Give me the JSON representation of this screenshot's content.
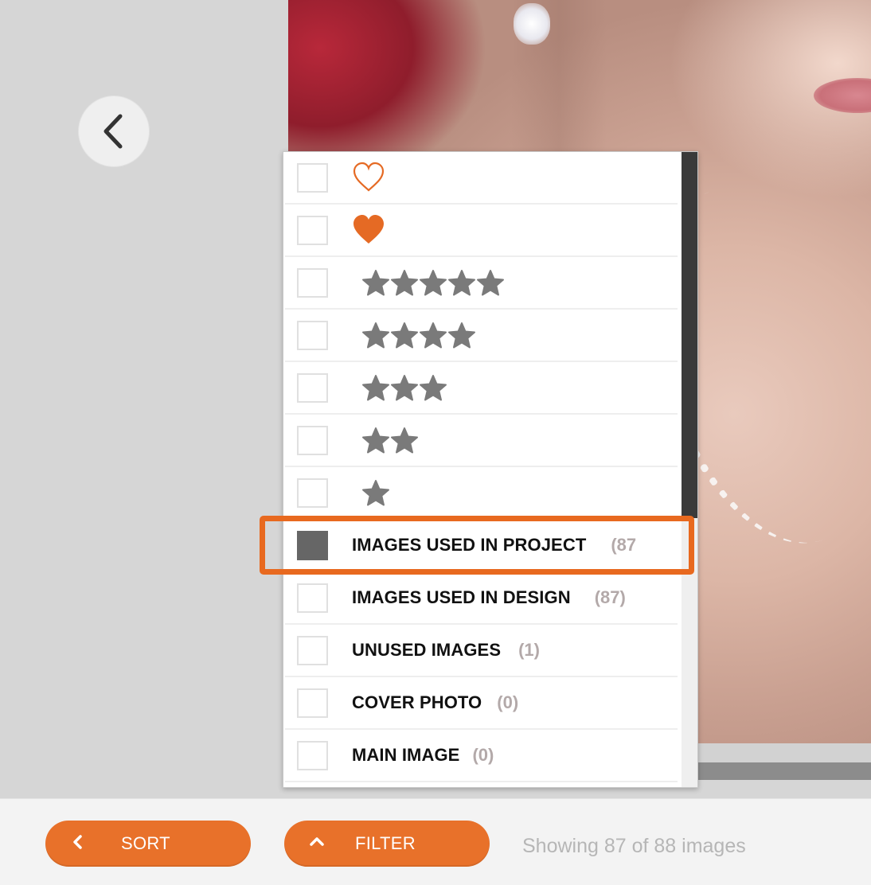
{
  "filter_menu": {
    "rows": [
      {
        "type": "icon",
        "icon": "heart-outline-icon",
        "checked": false
      },
      {
        "type": "icon",
        "icon": "heart-filled-icon",
        "checked": false
      },
      {
        "type": "stars",
        "stars": 5,
        "checked": false
      },
      {
        "type": "stars",
        "stars": 4,
        "checked": false
      },
      {
        "type": "stars",
        "stars": 3,
        "checked": false
      },
      {
        "type": "stars",
        "stars": 2,
        "checked": false
      },
      {
        "type": "stars",
        "stars": 1,
        "checked": false
      },
      {
        "type": "text",
        "label": "IMAGES USED IN PROJECT",
        "count": "(87",
        "checked": true
      },
      {
        "type": "text",
        "label": "IMAGES USED IN DESIGN",
        "count": "(87)",
        "checked": false
      },
      {
        "type": "text",
        "label": "UNUSED IMAGES",
        "count": "(1)",
        "checked": false
      },
      {
        "type": "text",
        "label": "COVER PHOTO",
        "count": "(0)",
        "checked": false
      },
      {
        "type": "text",
        "label": "MAIN IMAGE",
        "count": "(0)",
        "checked": false
      }
    ]
  },
  "footer": {
    "sort_label": "SORT",
    "filter_label": "FILTER",
    "status": "Showing 87 of 88 images"
  },
  "colors": {
    "accent": "#e8712a",
    "highlight": "#e8691f",
    "heart": "#e56a24",
    "star": "#7a7a7a",
    "count": "#b3a9a9"
  }
}
